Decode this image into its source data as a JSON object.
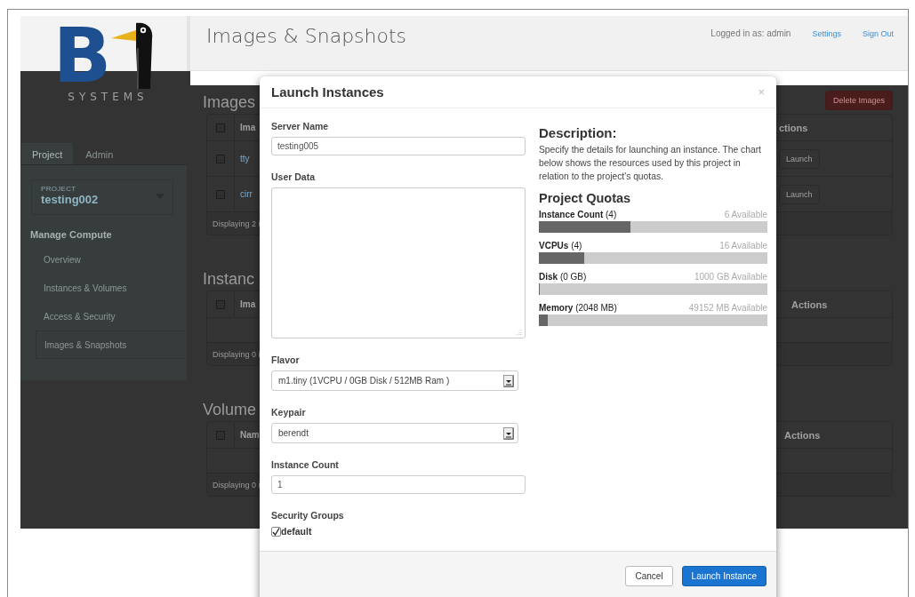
{
  "logo": {
    "letter": "B",
    "wordmark": "SYSTEMS"
  },
  "header": {
    "title": "Images & Snapshots",
    "user": "Logged in as: admin",
    "links": [
      "Settings",
      "Sign Out"
    ]
  },
  "sidebar": {
    "tabs": [
      {
        "label": "Project",
        "selected": true
      },
      {
        "label": "Admin",
        "selected": false
      }
    ],
    "project": {
      "caption": "PROJECT",
      "name": "testing002"
    },
    "section": "Manage Compute",
    "items": [
      {
        "label": "Overview",
        "selected": false
      },
      {
        "label": "Instances & Volumes",
        "selected": false
      },
      {
        "label": "Access & Security",
        "selected": false
      },
      {
        "label": "Images & Snapshots",
        "selected": true
      }
    ]
  },
  "main": {
    "delete_button": "Delete Images",
    "sections": [
      {
        "heading": "Images",
        "column_2": "Ima",
        "actions_header": "ctions",
        "select_all_checked": false,
        "rows": [
          {
            "name": "tty",
            "action": "Launch",
            "checked": false
          },
          {
            "name": "cirr",
            "action": "Launch",
            "checked": false
          }
        ],
        "footer": "Displaying 2 i"
      },
      {
        "heading": "Instanc",
        "column_2": "Ima",
        "actions_header": "Actions",
        "select_all_checked": false,
        "footer": "Displaying 0 i"
      },
      {
        "heading": "Volume",
        "column_2": "Nam",
        "actions_header": "Actions",
        "select_all_checked": false,
        "footer": "Displaying 0 i"
      }
    ]
  },
  "dialog": {
    "title": "Launch Instances",
    "close": "×",
    "fields": [
      {
        "kind": "text",
        "label": "Server Name",
        "value": "testing005"
      },
      {
        "kind": "textarea",
        "label": "User Data"
      },
      {
        "kind": "select",
        "label": "Flavor",
        "value": "m1.tiny (1VCPU / 0GB Disk / 512MB Ram )"
      },
      {
        "kind": "select",
        "label": "Keypair",
        "value": "berendt"
      },
      {
        "kind": "text",
        "label": "Instance Count",
        "value": "1"
      },
      {
        "kind": "checkboxes",
        "label": "Security Groups",
        "options": [
          {
            "label": "default",
            "checked": true
          }
        ]
      }
    ],
    "description": {
      "heading": "Description:",
      "text": "Specify the details for launching an instance. The chart below shows the resources used by this project in relation to the project's quotas."
    },
    "quotas": {
      "heading": "Project Quotas",
      "items": [
        {
          "label": "**Instance Count** (4)",
          "available": "6 Available",
          "level": 0.4
        },
        {
          "label": "**VCPUs** (4)",
          "available": "16 Available",
          "level": 0.2
        },
        {
          "label": "**Disk** (0 GB)",
          "available": "1000 GB Available",
          "level": 0
        },
        {
          "label": "**Memory** (2048 MB)",
          "available": "49152 MB Available",
          "level": 0.04
        }
      ]
    },
    "buttons": [
      {
        "label": "Cancel",
        "kind": "secondary"
      },
      {
        "label": "Launch Instance",
        "kind": "primary"
      }
    ]
  }
}
